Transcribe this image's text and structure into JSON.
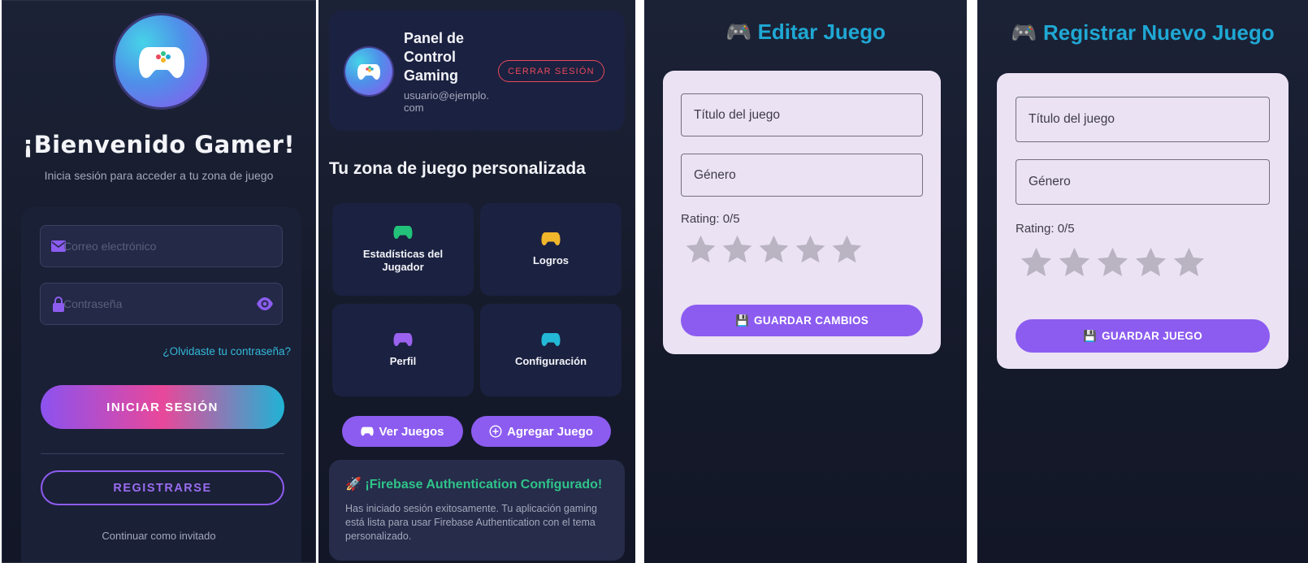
{
  "login": {
    "welcome": "¡Bienvenido Gamer!",
    "subtitle": "Inicia sesión para acceder a tu zona de juego",
    "email_placeholder": "Correo electrónico",
    "password_placeholder": "Contraseña",
    "forgot": "¿Olvidaste tu contraseña?",
    "login_button": "INICIAR SESIÓN",
    "register_button": "REGISTRARSE",
    "guest": "Continuar como invitado"
  },
  "dashboard": {
    "title": "Panel de Control Gaming",
    "email": "usuario@ejemplo.com",
    "logout": "CERRAR SESIÓN",
    "zone_title": "Tu zona de juego personalizada",
    "tiles": [
      {
        "label": "Estadísticas del Jugador",
        "color": "#22c27a"
      },
      {
        "label": "Logros",
        "color": "#f1b52c"
      },
      {
        "label": "Perfil",
        "color": "#9a62ee"
      },
      {
        "label": "Configuración",
        "color": "#22b8d6"
      }
    ],
    "view_games": "Ver Juegos",
    "add_game": "Agregar Juego",
    "firebase_title": "¡Firebase Authentication Configurado!",
    "firebase_text": "Has iniciado sesión exitosamente. Tu aplicación gaming está lista para usar Firebase Authentication con el tema personalizado."
  },
  "edit_game": {
    "title": "Editar Juego",
    "title_field": "Título del juego",
    "genre_field": "Género",
    "rating": "Rating: 0/5",
    "rating_value": 0,
    "save_button": "GUARDAR CAMBIOS"
  },
  "new_game": {
    "title": "Registrar Nuevo Juego",
    "title_field": "Título del juego",
    "genre_field": "Género",
    "rating": "Rating: 0/5",
    "rating_value": 0,
    "save_button": "GUARDAR JUEGO"
  },
  "colors": {
    "accent": "#8c5cf0",
    "cyan": "#1fa8d4",
    "danger": "#e8495c",
    "success": "#2fc48a"
  }
}
